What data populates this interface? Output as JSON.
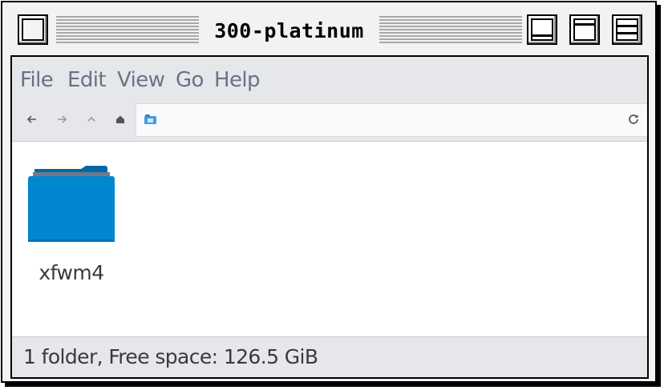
{
  "window": {
    "title": "300-platinum"
  },
  "menubar": {
    "items": [
      "File",
      "Edit",
      "View",
      "Go",
      "Help"
    ]
  },
  "toolbar": {
    "icons": [
      "back-arrow-icon",
      "forward-arrow-icon",
      "up-arrow-icon",
      "home-icon"
    ],
    "path_icon": "folder-icon",
    "reload_icon": "reload-icon"
  },
  "files": {
    "items": [
      {
        "name": "xfwm4",
        "icon": "folder-icon"
      }
    ]
  },
  "statusbar": {
    "text": "1 folder, Free space: 126.5 GiB"
  },
  "colors": {
    "folder_blue": "#0087d0",
    "folder_tab": "#0068a8",
    "menu_text": "#6b7287",
    "chrome_bg": "#e6e7ea"
  }
}
